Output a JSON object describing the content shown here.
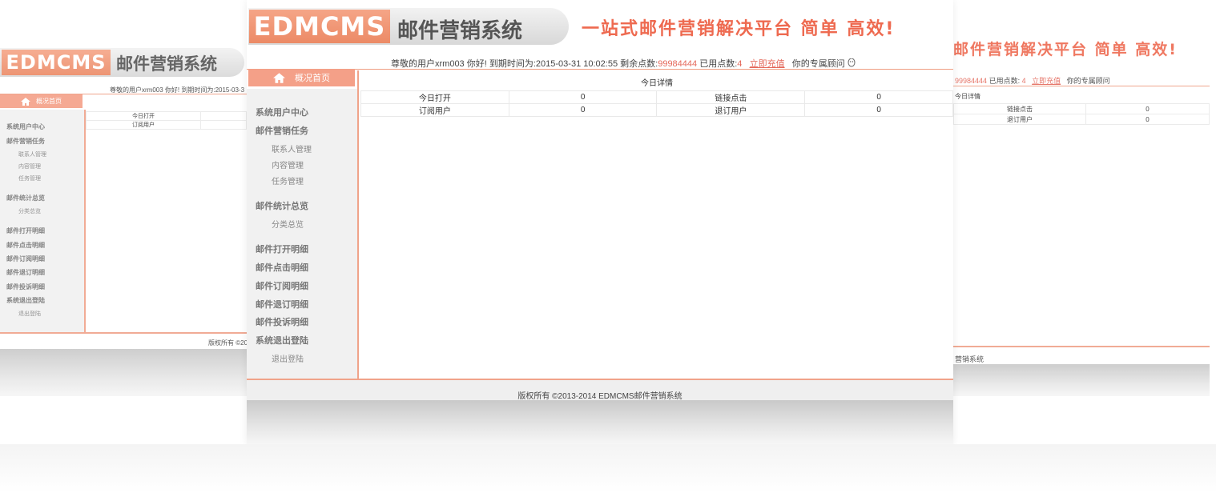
{
  "brand": {
    "logo_en": "EDMCMS",
    "logo_cn": "邮件营销系统",
    "slogan": "一站式邮件营销解决平台 简单 高效!",
    "slogan_right": "邮件营销解决平台 简单 高效!"
  },
  "info_bar": {
    "greeting": "尊敬的用户xrm003 你好!",
    "expiry_label": "到期时间为:",
    "expiry_value": "2015-03-31 10:02:55",
    "remaining_label": "剩余点数:",
    "remaining_value": "99984444",
    "used_label": "已用点数:",
    "used_value": "4",
    "recharge_link": "立即充值",
    "advisor_label": "你的专属顾问",
    "left_snippet": "尊敬的用户xrm003 你好! 到期时间为:2015-03-3"
  },
  "nav": {
    "home_tab": "概况首页",
    "sections": [
      {
        "title": "系统用户中心",
        "items": []
      },
      {
        "title": "邮件营销任务",
        "items": [
          "联系人管理",
          "内容管理",
          "任务管理"
        ]
      },
      {
        "title": "邮件统计总览",
        "items": [
          "分类总览"
        ]
      },
      {
        "title": "邮件打开明细",
        "items": []
      },
      {
        "title": "邮件点击明细",
        "items": []
      },
      {
        "title": "邮件订阅明细",
        "items": []
      },
      {
        "title": "邮件退订明细",
        "items": []
      },
      {
        "title": "邮件投诉明细",
        "items": []
      },
      {
        "title": "系统退出登陆",
        "items": [
          "退出登陆"
        ]
      }
    ]
  },
  "today": {
    "title": "今日详情",
    "rows": [
      [
        "今日打开",
        "0",
        "链接点击",
        "0"
      ],
      [
        "订阅用户",
        "0",
        "退订用户",
        "0"
      ]
    ]
  },
  "footer": {
    "copyright": "版权所有 ©2013-2014 EDMCMS邮件营销系统",
    "left_snippet": "版权所有 ©20",
    "right_snippet": "营销系统"
  },
  "colors": {
    "accent": "#f4a088",
    "accent_text": "#e4685a",
    "slogan": "#ee6a50",
    "sidebar_bg": "#f1f1f1"
  },
  "icons": {
    "home": "home-icon",
    "advisor": "qq-penguin-icon"
  }
}
